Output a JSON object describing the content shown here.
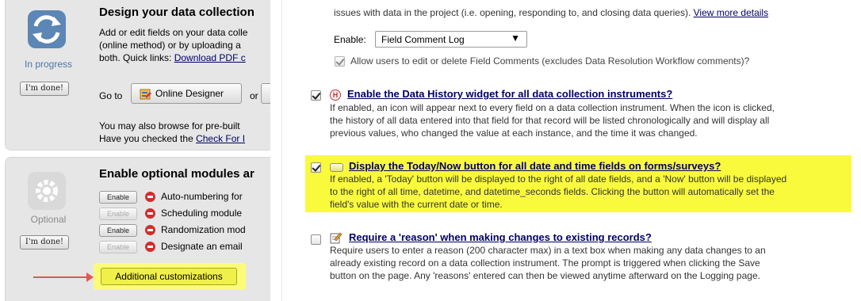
{
  "left": {
    "step1": {
      "title": "Design your data collection",
      "lines": [
        "Add or edit fields on your data colle",
        "(online method) or by uploading a",
        "both. Quick links: "
      ],
      "quick_link": "Download PDF c",
      "status": "In progress",
      "done_label": "I'm done!",
      "goto_label": "Go to",
      "online_designer_label": "Online Designer",
      "or_label": "or",
      "browse_line": "You may also browse for pre-built",
      "check_line": "Have you checked the ",
      "check_link": "Check For I"
    },
    "step2": {
      "title": "Enable optional modules ar",
      "status": "Optional",
      "done_label": "I'm done!",
      "modules": [
        {
          "button": "Enable",
          "label": "Auto-numbering for",
          "disabled": false
        },
        {
          "button": "Enable",
          "label": "Scheduling module",
          "disabled": true
        },
        {
          "button": "Enable",
          "label": "Randomization mod",
          "disabled": false
        },
        {
          "button": "Enable",
          "label": "Designate an email",
          "disabled": true
        }
      ],
      "additional_label": "Additional customizations"
    }
  },
  "right": {
    "top_text": "issues with data in the project (i.e. opening, responding to, and closing data queries). ",
    "view_more": "View more details",
    "enable_label": "Enable:",
    "select_value": "Field Comment Log",
    "allow_text": "Allow users to edit or delete Field Comments (excludes Data Resolution Workflow comments)?",
    "history": {
      "title": "Enable the Data History widget for all data collection instruments?",
      "icon_glyph": "H",
      "lines": [
        "If enabled, an icon will appear next to every field on a data collection instrument. When the icon is clicked,",
        "the history of all data entered into that field for that record will be listed chronologically and will display all",
        "previous values, who changed the value at each instance, and the time it was changed."
      ]
    },
    "today": {
      "title": "Display the Today/Now button for all date and time fields on forms/surveys?",
      "lines": [
        "If enabled, a 'Today' button will be displayed to the right of all date fields, and a 'Now' button will be displayed",
        "to the right of all time, datetime, and datetime_seconds fields. Clicking the button will automatically set the",
        "field's value with the current date or time."
      ]
    },
    "reason": {
      "title": "Require a 'reason' when making changes to existing records?",
      "lines": [
        "Require users to enter a reason (200 character max) in a text box when making any data changes to an",
        "already existing record on a data collection instrument. The prompt is triggered when clicking the Save",
        "button on the page. Any 'reasons' entered can then be viewed anytime afterward on the Logging page."
      ]
    }
  },
  "colors": {
    "highlight": "#fafa3c",
    "link": "#000066",
    "arrow": "#e5574f",
    "no_icon": "#d12e2e",
    "panel_bg": "#e6e6e6"
  },
  "icons": {
    "step1": "sync-arrows-icon",
    "step2": "gear-icon",
    "designer": "designer-icon",
    "history": "history-h-icon",
    "today": "button-icon",
    "reason": "pencil-note-icon",
    "disabled_module": "no-entry-icon"
  }
}
